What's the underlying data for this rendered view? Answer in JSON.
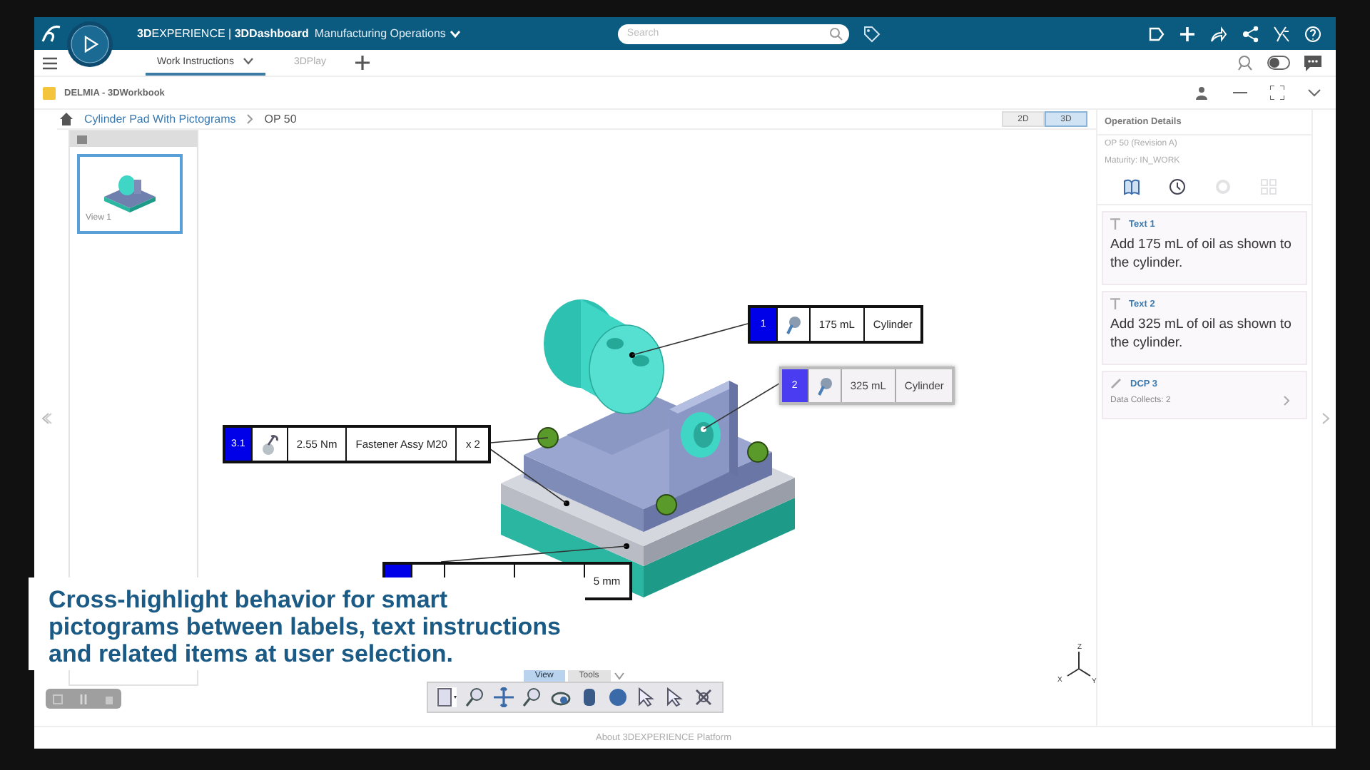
{
  "top_bar": {
    "brand": "**3D**EXPERIENCE | **3DDashboard**",
    "dashboard": "Manufacturing Operations",
    "search": {
      "placeholder": "Search"
    }
  },
  "tabs": [
    {
      "label": "Work Instructions",
      "selected": true,
      "has_menu": true
    },
    {
      "label": "3DPlay",
      "selected": false,
      "has_menu": false
    }
  ],
  "widget": {
    "title": "DELMIA - 3DWorkbook"
  },
  "breadcrumb": [
    "Cylinder Pad With Pictograms",
    "OP 50"
  ],
  "view_modes": [
    {
      "label": "2D",
      "selected": false
    },
    {
      "label": "3D",
      "selected": true
    }
  ],
  "thumbnails": [
    {
      "label": "View 1",
      "selected": true
    }
  ],
  "labels": [
    {
      "number": "1",
      "kind": "oil",
      "selected": false,
      "cells": [
        "175 mL",
        "Cylinder"
      ]
    },
    {
      "number": "2",
      "kind": "oil",
      "selected": true,
      "cells": [
        "325 mL",
        "Cylinder"
      ]
    },
    {
      "number": "3.1",
      "kind": "torque",
      "selected": false,
      "cells": [
        "2.55 Nm",
        "Fastener Assy M20",
        "x 2"
      ]
    },
    {
      "kind": "dimension",
      "selected": false,
      "cells": [
        "5 mm"
      ]
    }
  ],
  "axis_triad": {
    "z": "Z",
    "x": "X",
    "y": "Y"
  },
  "viewer_toolbar": {
    "tabs": [
      {
        "label": "View",
        "selected": true
      },
      {
        "label": "Tools",
        "selected": false
      }
    ]
  },
  "operation": {
    "title": "Operation Details",
    "revision": "OP 50 (Revision A)",
    "maturity": "Maturity: IN_WORK",
    "tools": [
      {
        "disabled": false
      },
      {
        "disabled": false
      },
      {
        "disabled": true
      },
      {
        "disabled": true
      }
    ]
  },
  "instructions": [
    {
      "kind": "text",
      "title": "Text 1",
      "body": "Add 175 mL of oil as shown to the cylinder."
    },
    {
      "kind": "text",
      "title": "Text 2",
      "body": "Add 325 mL of oil as shown to the cylinder."
    },
    {
      "kind": "data_collect",
      "title": "DCP 3",
      "body": "Data Collects: 2"
    }
  ],
  "caption": "Cross-highlight behavior for smart pictograms between labels, text instructions and related items at user selection.",
  "footer": "About 3DEXPERIENCE Platform"
}
